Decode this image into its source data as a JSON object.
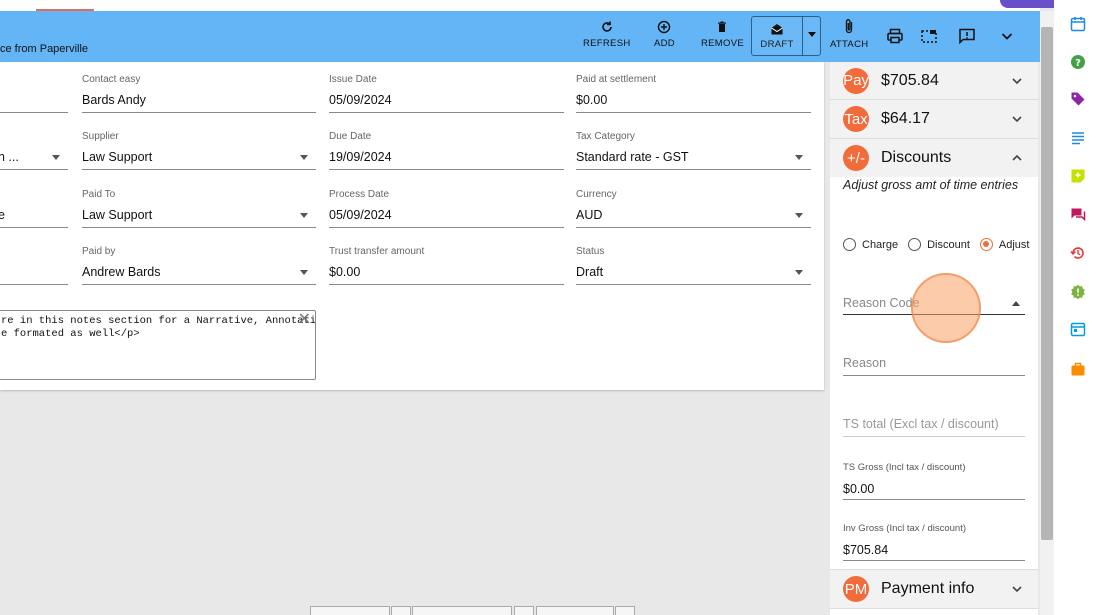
{
  "header": {
    "title": "ce from Paperville",
    "buttons": {
      "refresh": "REFRESH",
      "add": "ADD",
      "remove": "REMOVE",
      "draft": "DRAFT",
      "attach": "ATTACH"
    }
  },
  "form": {
    "col1": [
      {
        "value": ""
      },
      {
        "value": "n ..."
      },
      {
        "value": "e"
      },
      {
        "value": ""
      }
    ],
    "col2": [
      {
        "label": "Contact easy",
        "value": "Bards Andy"
      },
      {
        "label": "Supplier",
        "value": "Law Support"
      },
      {
        "label": "Paid To",
        "value": "Law Support"
      },
      {
        "label": "Paid by",
        "value": "Andrew Bards"
      }
    ],
    "col3": [
      {
        "label": "Issue Date",
        "value": "05/09/2024"
      },
      {
        "label": "Due Date",
        "value": "19/09/2024"
      },
      {
        "label": "Process Date",
        "value": "05/09/2024"
      },
      {
        "label": "Trust transfer amount",
        "value": "$0.00"
      }
    ],
    "col4": [
      {
        "label": "Paid at settlement",
        "value": "$0.00"
      },
      {
        "label": "Tax Category",
        "value": "Standard rate - GST"
      },
      {
        "label": "Currency",
        "value": "AUD"
      },
      {
        "label": "Status",
        "value": "Draft"
      }
    ],
    "notes": "re in this notes section for a Narrative, Annotation\ne formated as well</p>"
  },
  "panel": {
    "pay": {
      "badge": "Pay",
      "amount": "$705.84"
    },
    "tax": {
      "badge": "Tax",
      "amount": "$64.17"
    },
    "discounts": {
      "badge": "+/-",
      "title": "Discounts",
      "description": "Adjust gross amt of time entries",
      "options": [
        "Charge",
        "Discount",
        "Adjust"
      ],
      "selected": "Adjust",
      "reason_code_placeholder": "Reason Code",
      "reason_placeholder": "Reason",
      "ts_total_placeholder": "TS total (Excl tax / discount)",
      "ts_gross_label": "TS Gross (Incl tax / discount)",
      "ts_gross_value": "$0.00",
      "inv_gross_label": "Inv Gross (Incl tax / discount)",
      "inv_gross_value": "$705.84"
    },
    "payment_info": {
      "badge": "PM",
      "title": "Payment info"
    }
  },
  "colors": {
    "header": "#64b5f6",
    "accent": "#f26b3a"
  }
}
